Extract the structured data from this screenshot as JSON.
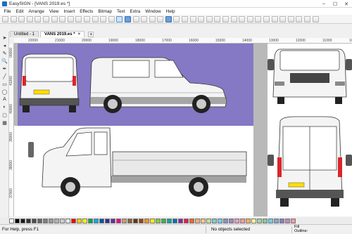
{
  "window": {
    "title": "EasySIGN - [VANS 2019.es *]",
    "minimize": "–",
    "maximize": "☐",
    "close": "✕"
  },
  "menu": [
    "File",
    "Edit",
    "Arrange",
    "View",
    "Insert",
    "Effects",
    "Bitmap",
    "Text",
    "Extra",
    "Window",
    "Help"
  ],
  "tabs": [
    {
      "label": "Untitled - 1",
      "active": false
    },
    {
      "label": "VANS 2019.es *",
      "active": true
    }
  ],
  "tab_add": "+",
  "tab_close": "×",
  "ruler": {
    "h": [
      "22000",
      "21000",
      "20000",
      "19000",
      "18000",
      "17000",
      "16000",
      "15000",
      "14000",
      "13000",
      "12000",
      "11000",
      "10000"
    ],
    "v": [
      "00000",
      "41000",
      "40000",
      "39000",
      "38000",
      "37000"
    ]
  },
  "palette": [
    "#ffffff",
    "#000000",
    "#1a1a1a",
    "#333333",
    "#4d4d4d",
    "#666666",
    "#808080",
    "#999999",
    "#b3b3b3",
    "#cccccc",
    "#e6e6e6",
    "#ff0000",
    "#ffcc00",
    "#ffff00",
    "#00a650",
    "#00aeef",
    "#0054a6",
    "#2e3192",
    "#662d91",
    "#ec008c",
    "#c69c6d",
    "#8b5e3c",
    "#603913",
    "#a0410d",
    "#f7941d",
    "#fff200",
    "#8dc63f",
    "#39b54a",
    "#00a99d",
    "#0072bc",
    "#92278f",
    "#ed145b",
    "#f26522",
    "#f9ad81",
    "#fdc689",
    "#c4df9b",
    "#7accc8",
    "#6dcff6",
    "#8393ca",
    "#a186be",
    "#f49ac1",
    "#f6989d",
    "#fbaf5d",
    "#fff799",
    "#a3d39c",
    "#82ca9c",
    "#6ecff6",
    "#7da7d9",
    "#8781bd",
    "#bd8cbf",
    "#f5989d"
  ],
  "status": {
    "help": "For Help, press F1",
    "selection": "No objects selected",
    "fill_label": "Fill",
    "outline_label": "Outline:"
  },
  "colors": {
    "accent": "#1a6fc4",
    "canvas_purple": "#8578c4",
    "canvas_gray": "#b9b9b9",
    "plate": "#ffde00",
    "van_red": "#d9262c"
  }
}
